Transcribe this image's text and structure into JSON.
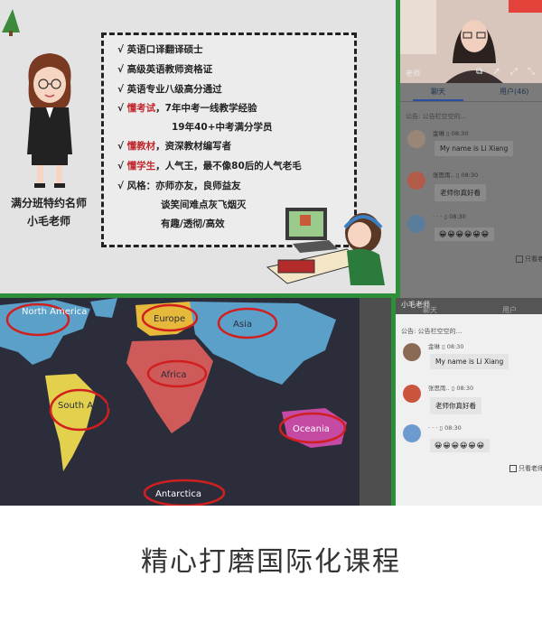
{
  "slide": {
    "teacher_title": "满分班特约名师",
    "teacher_name": "小毛老师",
    "bullets": [
      {
        "prefix": "√ ",
        "highlight": "",
        "text": "英语口译翻译硕士"
      },
      {
        "prefix": "√ ",
        "highlight": "",
        "text": "高级英语教师资格证"
      },
      {
        "prefix": "√ ",
        "highlight": "",
        "text": "英语专业八级高分通过"
      },
      {
        "prefix": "√ ",
        "highlight": "懂考试",
        "text": "，7年中考一线教学经验"
      },
      {
        "prefix": "",
        "highlight": "",
        "text": "19年40+中考满分学员"
      },
      {
        "prefix": "√ ",
        "highlight": "懂教材",
        "text": "，资深教材编写者"
      },
      {
        "prefix": "√ ",
        "highlight": "懂学生",
        "text": "，人气王，最不像80后的人气老毛"
      },
      {
        "prefix": "√ ",
        "highlight": "",
        "text": "风格：亦师亦友，良师益友"
      },
      {
        "prefix": "",
        "highlight": "",
        "text": "谈笑间难点灰飞烟灭"
      },
      {
        "prefix": "",
        "highlight": "",
        "text": "有趣/透彻/高效"
      }
    ]
  },
  "video": {
    "label": "老师",
    "controls": "⧉ ↗ ⤢ ⤡"
  },
  "chat_top": {
    "tab_chat": "聊天",
    "tab_users": "用户(46)",
    "notice": "公告: 公告栏空空的...",
    "messages": [
      {
        "name": "金琳",
        "time": "08:30",
        "text": "My name is Li Xiang"
      },
      {
        "name": "张思雨..",
        "time": "08:30",
        "text": "老师你真好看"
      },
      {
        "name": "· · ·",
        "time": "08:30",
        "text": "😀😀😀😀😀😀"
      }
    ],
    "only_teacher": "只看老师"
  },
  "map": {
    "labels": [
      "North America",
      "Europe",
      "Asia",
      "Africa",
      "South America",
      "Oceania",
      "Antarctica"
    ]
  },
  "chat_mid": {
    "header": "小毛老师",
    "tab_chat": "聊天",
    "tab_users": "用户",
    "notice": "公告: 公告栏空空的...",
    "messages": [
      {
        "name": "金琳",
        "time": "08:30",
        "text": "My name is Li Xiang"
      },
      {
        "name": "张思雨..",
        "time": "08:30",
        "text": "老师你真好看"
      },
      {
        "name": "· · ·",
        "time": "08:30",
        "text": "😀😀😀😀😀😀"
      }
    ],
    "only_teacher": "只看老师"
  },
  "caption": "精心打磨国际化课程",
  "colors": {
    "accent_green": "#2e8f3a",
    "highlight_red": "#c0282e",
    "circle_red": "#d11f1f"
  }
}
